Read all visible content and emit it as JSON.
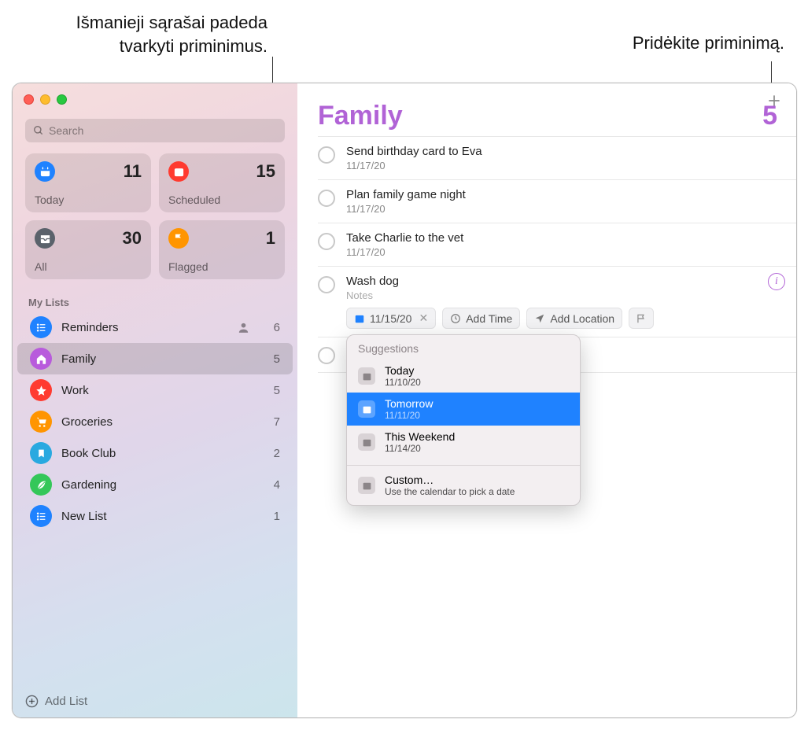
{
  "callouts": {
    "smart_lists": "Išmanieji sąrašai padeda\ntvarkyti priminimus.",
    "add_reminder": "Pridėkite priminimą."
  },
  "search": {
    "placeholder": "Search"
  },
  "smart": {
    "today": {
      "label": "Today",
      "count": 11,
      "color": "#1f82ff"
    },
    "scheduled": {
      "label": "Scheduled",
      "count": 15,
      "color": "#ff3b30"
    },
    "all": {
      "label": "All",
      "count": 30,
      "color": "#5a626b"
    },
    "flagged": {
      "label": "Flagged",
      "count": 1,
      "color": "#ff9500"
    }
  },
  "section_header": "My Lists",
  "lists": [
    {
      "name": "Reminders",
      "count": 6,
      "color": "#1f82ff",
      "icon": "list",
      "shared": true
    },
    {
      "name": "Family",
      "count": 5,
      "color": "#b85bdc",
      "icon": "home",
      "selected": true
    },
    {
      "name": "Work",
      "count": 5,
      "color": "#ff3b30",
      "icon": "star"
    },
    {
      "name": "Groceries",
      "count": 7,
      "color": "#ff9500",
      "icon": "cart"
    },
    {
      "name": "Book Club",
      "count": 2,
      "color": "#29a9e0",
      "icon": "bookmark"
    },
    {
      "name": "Gardening",
      "count": 4,
      "color": "#34c759",
      "icon": "leaf"
    },
    {
      "name": "New List",
      "count": 1,
      "color": "#1f82ff",
      "icon": "list"
    }
  ],
  "add_list_label": "Add List",
  "main": {
    "title": "Family",
    "count": 5,
    "accent": "#b163d6"
  },
  "reminders": [
    {
      "title": "Send birthday card to Eva",
      "date": "11/17/20"
    },
    {
      "title": "Plan family game night",
      "date": "11/17/20"
    },
    {
      "title": "Take Charlie to the vet",
      "date": "11/17/20"
    },
    {
      "title": "Wash dog",
      "notes_placeholder": "Notes",
      "editing": true,
      "chips": {
        "date": "11/15/20",
        "add_time": "Add Time",
        "add_location": "Add Location"
      }
    }
  ],
  "suggestions": {
    "header": "Suggestions",
    "items": [
      {
        "title": "Today",
        "date": "11/10/20"
      },
      {
        "title": "Tomorrow",
        "date": "11/11/20",
        "selected": true
      },
      {
        "title": "This Weekend",
        "date": "11/14/20"
      }
    ],
    "custom": {
      "title": "Custom…",
      "hint": "Use the calendar to pick a date"
    }
  }
}
